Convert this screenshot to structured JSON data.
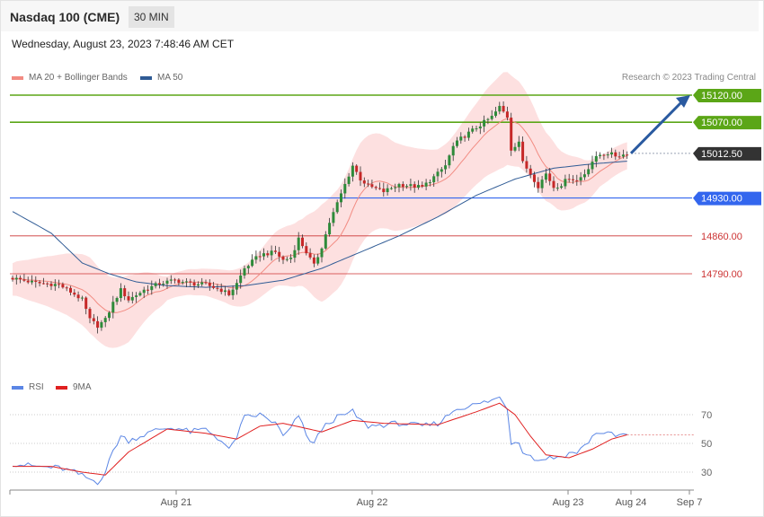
{
  "header": {
    "title": "Nasdaq 100 (CME)",
    "timeframe": "30 MIN",
    "datetime": "Wednesday, August 23, 2023 7:48:46 AM CET"
  },
  "legend_main": [
    {
      "label": "MA 20 + Bollinger Bands",
      "color": "#f28b82"
    },
    {
      "label": "MA 50",
      "color": "#2f5b95"
    }
  ],
  "legend_rsi": [
    {
      "label": "RSI",
      "color": "#5b86e5"
    },
    {
      "label": "9MA",
      "color": "#e02020"
    }
  ],
  "copyright": "Research © 2023 Trading Central",
  "colors": {
    "up_candle": "#2e8b3a",
    "down_candle": "#c62828",
    "resistance": "#5ba617",
    "pivot": "#3366ee",
    "support": "#cc3333",
    "band_fill": "#fdd8d8",
    "arrow": "#2a5aa0",
    "current": "#333333"
  },
  "chart_data": [
    {
      "type": "candlestick",
      "x_ticks": [
        "Aug 21",
        "Aug 22",
        "Aug 23",
        "Aug 24",
        "Sep 7"
      ],
      "ylim": [
        14690,
        15135
      ],
      "price_levels": [
        {
          "value": 15120,
          "label": "15120.00",
          "kind": "resistance"
        },
        {
          "value": 15070,
          "label": "15070.00",
          "kind": "resistance"
        },
        {
          "value": 15012.5,
          "label": "15012.50",
          "kind": "current"
        },
        {
          "value": 14930,
          "label": "14930.00",
          "kind": "pivot"
        },
        {
          "value": 14860,
          "label": "14860.00",
          "kind": "support"
        },
        {
          "value": 14790,
          "label": "14790.00",
          "kind": "support"
        }
      ],
      "close_waypoints": [
        [
          0,
          14782
        ],
        [
          6,
          14773
        ],
        [
          12,
          14770
        ],
        [
          16,
          14752
        ],
        [
          18,
          14742
        ],
        [
          20,
          14705
        ],
        [
          22,
          14694
        ],
        [
          24,
          14705
        ],
        [
          26,
          14736
        ],
        [
          28,
          14760
        ],
        [
          30,
          14742
        ],
        [
          34,
          14760
        ],
        [
          38,
          14772
        ],
        [
          42,
          14778
        ],
        [
          46,
          14772
        ],
        [
          50,
          14770
        ],
        [
          54,
          14760
        ],
        [
          56,
          14752
        ],
        [
          58,
          14772
        ],
        [
          60,
          14800
        ],
        [
          64,
          14825
        ],
        [
          68,
          14830
        ],
        [
          70,
          14815
        ],
        [
          72,
          14820
        ],
        [
          74,
          14855
        ],
        [
          76,
          14830
        ],
        [
          78,
          14805
        ],
        [
          80,
          14840
        ],
        [
          82,
          14885
        ],
        [
          84,
          14920
        ],
        [
          86,
          14955
        ],
        [
          88,
          14990
        ],
        [
          90,
          14965
        ],
        [
          92,
          14952
        ],
        [
          96,
          14942
        ],
        [
          100,
          14955
        ],
        [
          106,
          14950
        ],
        [
          110,
          14975
        ],
        [
          112,
          14990
        ],
        [
          114,
          15025
        ],
        [
          116,
          15040
        ],
        [
          120,
          15060
        ],
        [
          124,
          15080
        ],
        [
          126,
          15098
        ],
        [
          128,
          15080
        ],
        [
          129,
          15020
        ],
        [
          131,
          15035
        ],
        [
          132,
          14995
        ],
        [
          134,
          14975
        ],
        [
          136,
          14952
        ],
        [
          138,
          14975
        ],
        [
          140,
          14950
        ],
        [
          142,
          14955
        ],
        [
          144,
          14968
        ],
        [
          146,
          14962
        ],
        [
          148,
          14975
        ],
        [
          150,
          14998
        ],
        [
          152,
          15010
        ],
        [
          154,
          15013
        ],
        [
          156,
          15008
        ],
        [
          158,
          15010
        ],
        [
          159,
          15012
        ]
      ],
      "bollinger_half_width_waypoints": [
        [
          0,
          30
        ],
        [
          10,
          48
        ],
        [
          20,
          70
        ],
        [
          30,
          62
        ],
        [
          40,
          22
        ],
        [
          50,
          25
        ],
        [
          55,
          30
        ],
        [
          65,
          45
        ],
        [
          75,
          62
        ],
        [
          80,
          90
        ],
        [
          90,
          95
        ],
        [
          100,
          80
        ],
        [
          110,
          62
        ],
        [
          120,
          75
        ],
        [
          127,
          88
        ],
        [
          135,
          70
        ],
        [
          145,
          48
        ],
        [
          152,
          28
        ],
        [
          159,
          25
        ]
      ],
      "ma50_waypoints": [
        [
          0,
          14905
        ],
        [
          10,
          14865
        ],
        [
          18,
          14810
        ],
        [
          25,
          14790
        ],
        [
          32,
          14775
        ],
        [
          40,
          14768
        ],
        [
          50,
          14765
        ],
        [
          60,
          14768
        ],
        [
          70,
          14778
        ],
        [
          80,
          14800
        ],
        [
          90,
          14830
        ],
        [
          100,
          14860
        ],
        [
          110,
          14895
        ],
        [
          120,
          14935
        ],
        [
          130,
          14965
        ],
        [
          140,
          14985
        ],
        [
          150,
          14993
        ],
        [
          159,
          14998
        ]
      ]
    },
    {
      "type": "line",
      "name": "RSI",
      "levels": [
        {
          "value": 70,
          "label": "70"
        },
        {
          "value": 50,
          "label": "50"
        },
        {
          "value": 30,
          "label": "30"
        }
      ],
      "ylim": [
        10,
        90
      ],
      "rsi_waypoints": [
        [
          0,
          36
        ],
        [
          6,
          34
        ],
        [
          12,
          33
        ],
        [
          16,
          30
        ],
        [
          20,
          25
        ],
        [
          22,
          23
        ],
        [
          24,
          30
        ],
        [
          26,
          45
        ],
        [
          28,
          55
        ],
        [
          30,
          52
        ],
        [
          34,
          56
        ],
        [
          38,
          60
        ],
        [
          42,
          61
        ],
        [
          46,
          58
        ],
        [
          50,
          60
        ],
        [
          54,
          52
        ],
        [
          56,
          45
        ],
        [
          58,
          55
        ],
        [
          60,
          68
        ],
        [
          64,
          70
        ],
        [
          68,
          64
        ],
        [
          70,
          55
        ],
        [
          72,
          60
        ],
        [
          74,
          70
        ],
        [
          76,
          55
        ],
        [
          78,
          50
        ],
        [
          80,
          60
        ],
        [
          82,
          65
        ],
        [
          84,
          68
        ],
        [
          86,
          70
        ],
        [
          88,
          72
        ],
        [
          90,
          66
        ],
        [
          92,
          62
        ],
        [
          96,
          63
        ],
        [
          100,
          64
        ],
        [
          106,
          62
        ],
        [
          110,
          64
        ],
        [
          112,
          68
        ],
        [
          114,
          73
        ],
        [
          116,
          75
        ],
        [
          120,
          77
        ],
        [
          124,
          80
        ],
        [
          126,
          82
        ],
        [
          128,
          75
        ],
        [
          129,
          50
        ],
        [
          131,
          52
        ],
        [
          132,
          45
        ],
        [
          134,
          41
        ],
        [
          136,
          38
        ],
        [
          138,
          40
        ],
        [
          140,
          40
        ],
        [
          142,
          41
        ],
        [
          144,
          43
        ],
        [
          146,
          44
        ],
        [
          148,
          48
        ],
        [
          150,
          55
        ],
        [
          152,
          58
        ],
        [
          154,
          57
        ],
        [
          156,
          55
        ],
        [
          158,
          56
        ],
        [
          159,
          56
        ]
      ],
      "ma9_waypoints": [
        [
          0,
          34
        ],
        [
          10,
          34
        ],
        [
          18,
          30
        ],
        [
          24,
          28
        ],
        [
          30,
          44
        ],
        [
          40,
          60
        ],
        [
          50,
          57
        ],
        [
          58,
          53
        ],
        [
          64,
          62
        ],
        [
          70,
          64
        ],
        [
          80,
          58
        ],
        [
          88,
          66
        ],
        [
          96,
          64
        ],
        [
          110,
          63
        ],
        [
          120,
          72
        ],
        [
          126,
          78
        ],
        [
          130,
          70
        ],
        [
          134,
          55
        ],
        [
          138,
          42
        ],
        [
          144,
          40
        ],
        [
          150,
          46
        ],
        [
          155,
          53
        ],
        [
          159,
          56
        ]
      ]
    }
  ]
}
